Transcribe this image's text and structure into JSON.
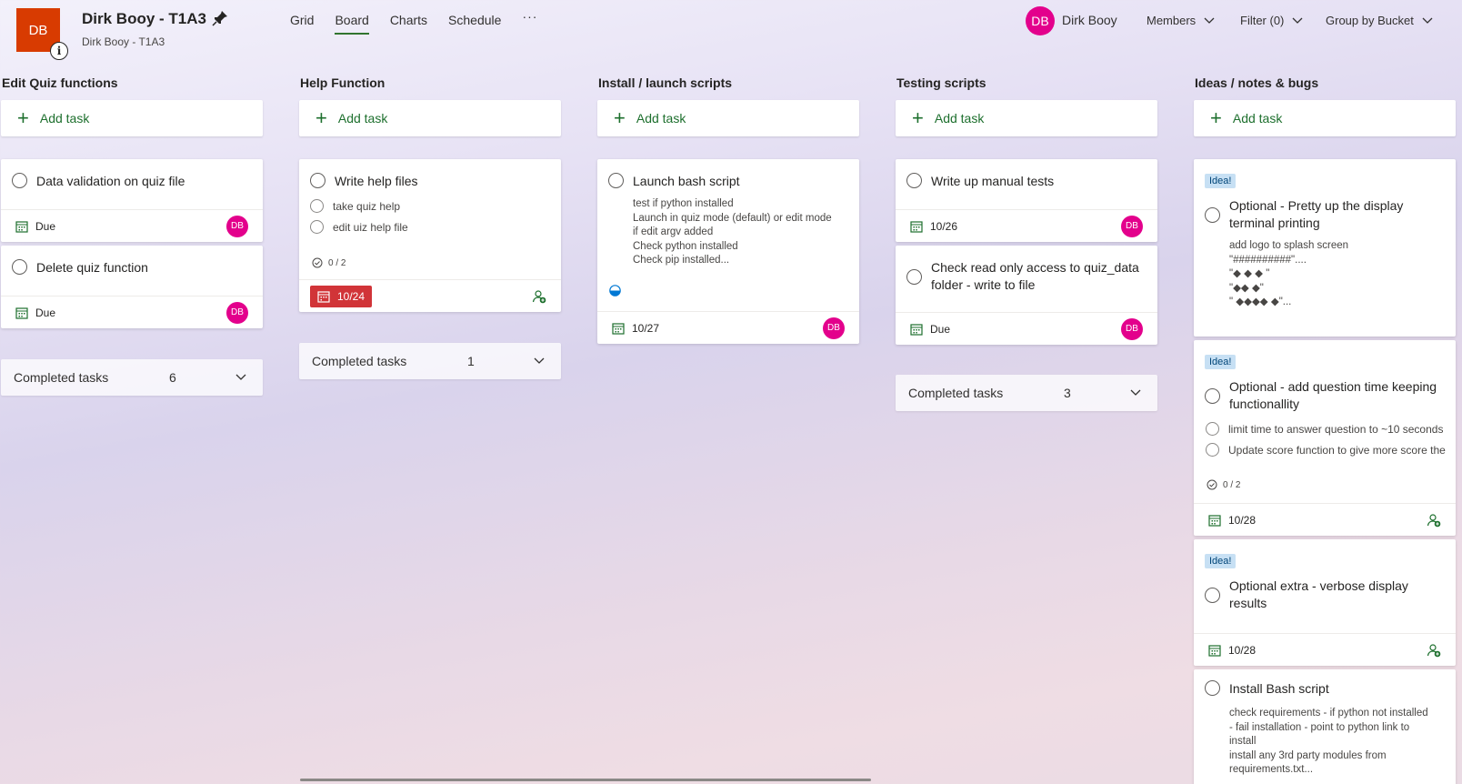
{
  "header": {
    "avatar_initials": "DB",
    "plan_title": "Dirk Booy - T1A3",
    "plan_subtitle": "Dirk Booy - T1A3",
    "tabs": [
      "Grid",
      "Board",
      "Charts",
      "Schedule"
    ],
    "active_tab": "Board",
    "more": "···",
    "user_initials": "DB",
    "user_name": "Dirk Booy",
    "members_label": "Members",
    "filter_label": "Filter (0)",
    "group_label": "Group by Bucket"
  },
  "add_task_label": "Add task",
  "completed_label": "Completed tasks",
  "buckets": [
    {
      "title": "Edit Quiz functions",
      "cards": [
        {
          "title": "Data validation on quiz file",
          "due": "Due",
          "assignee": "DB"
        },
        {
          "title": "Delete quiz function",
          "due": "Due",
          "assignee": "DB"
        }
      ],
      "completed_count": "6"
    },
    {
      "title": "Help Function",
      "cards": [
        {
          "title": "Write help files",
          "checklist": [
            "take quiz help",
            "edit uiz help file"
          ],
          "progress": "0 / 2",
          "due": "10/24"
        }
      ],
      "completed_count": "1"
    },
    {
      "title": "Install / launch scripts",
      "cards": [
        {
          "title": "Launch bash script",
          "description": [
            "test if python installed",
            "Launch in quiz mode (default) or edit mode",
            "if edit argv added",
            "Check python installed",
            "Check pip installed..."
          ],
          "due": "10/27",
          "assignee": "DB"
        }
      ]
    },
    {
      "title": "Testing scripts",
      "cards": [
        {
          "title": "Write up manual tests",
          "due": "10/26",
          "assignee": "DB"
        },
        {
          "title": "Check read only access to quiz_data folder - write to file",
          "due": "Due",
          "assignee": "DB"
        }
      ],
      "completed_count": "3"
    },
    {
      "title": "Ideas / notes & bugs",
      "cards": [
        {
          "label": "Idea!",
          "title": "Optional - Pretty up the display terminal printing",
          "description": [
            "add logo to splash screen",
            "\"##########\"....",
            "\"◆ ◆ ◆  \"",
            "\"◆◆    ◆\"",
            "\" ◆◆◆◆  ◆\"..."
          ]
        },
        {
          "label": "Idea!",
          "title": "Optional - add question time keeping functionallity",
          "checklist": [
            "limit time to answer question to ~10 seconds",
            "Update score function to give more score the"
          ],
          "progress": "0 / 2",
          "due": "10/28"
        },
        {
          "label": "Idea!",
          "title": "Optional extra - verbose display results",
          "due": "10/28"
        },
        {
          "title": "Install Bash script",
          "description": [
            "check requirements - if python not installed",
            "- fail installation - point to python link to",
            "install",
            "install any 3rd party modules from",
            "requirements.txt..."
          ]
        }
      ]
    }
  ]
}
